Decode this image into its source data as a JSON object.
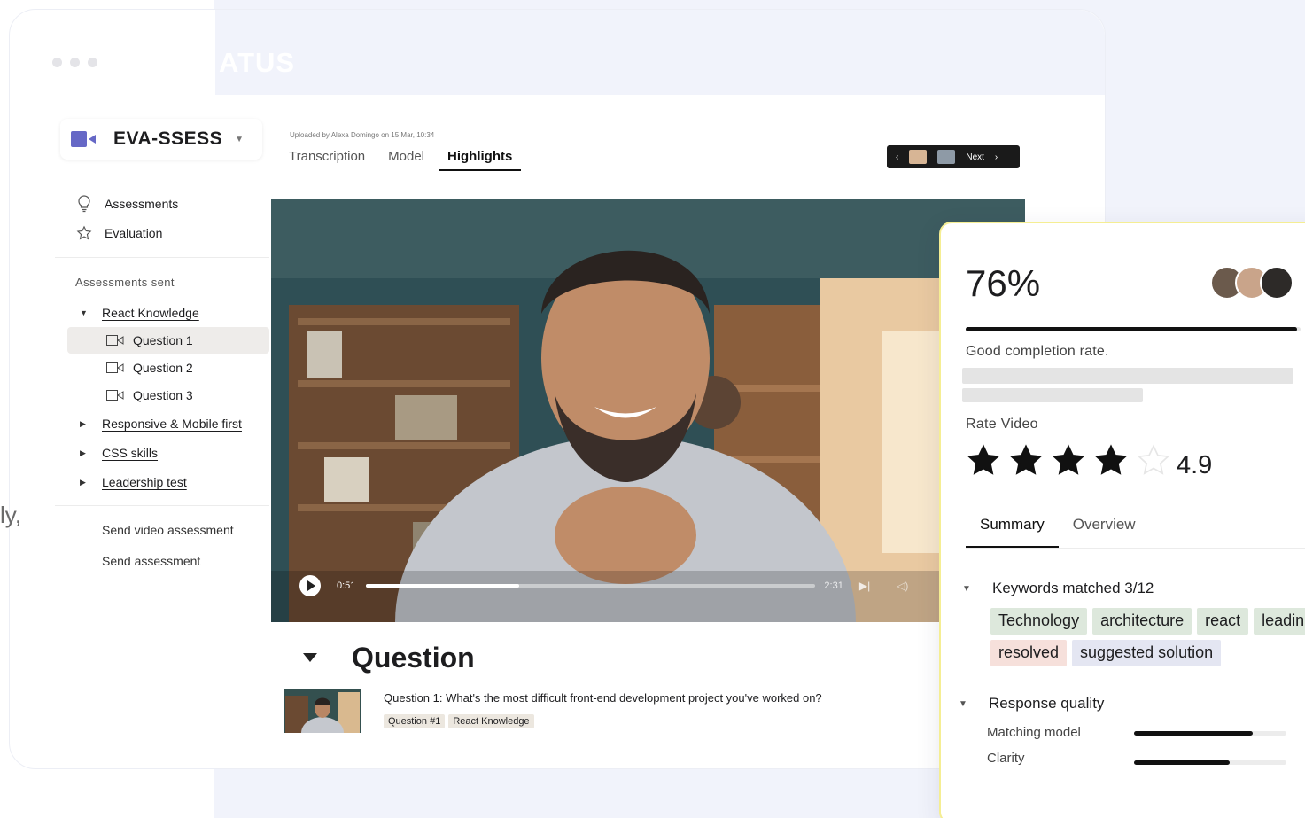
{
  "window": {
    "brand_ghost": "ATUS",
    "side_text": "ly,"
  },
  "app": {
    "logo_text": "EVA-SSESS",
    "nav": [
      {
        "label": "Assessments",
        "icon": "lightbulb-icon"
      },
      {
        "label": "Evaluation",
        "icon": "star-outline-icon"
      }
    ],
    "section_label": "Assessments sent",
    "groups": [
      {
        "label": "React Knowledge",
        "expanded": true
      },
      {
        "label": "Responsive & Mobile first",
        "expanded": false
      },
      {
        "label": "CSS skills",
        "expanded": false
      },
      {
        "label": "Leadership test",
        "expanded": false
      }
    ],
    "questions": [
      {
        "label": "Question 1",
        "selected": true
      },
      {
        "label": "Question 2",
        "selected": false
      },
      {
        "label": "Question 3",
        "selected": false
      }
    ],
    "send_items": [
      "Send video assessment",
      "Send assessment"
    ]
  },
  "header": {
    "upload_meta": "Uploaded by Alexa Domingo on 15 Mar, 10:34",
    "tabs": [
      {
        "label": "Transcription",
        "active": false
      },
      {
        "label": "Model",
        "active": false
      },
      {
        "label": "Highlights",
        "active": true
      }
    ],
    "next_label": "Next"
  },
  "video": {
    "current_time": "0:51",
    "end_time": "2:31",
    "progress": 0.34
  },
  "question": {
    "title": "Question",
    "text": "Question 1: What's the most difficult front-end development project you've worked on?",
    "tags": [
      "Question #1",
      "React Knowledge"
    ]
  },
  "score": {
    "percent": "76%",
    "completion_value": 0.99,
    "completion_text": "Good completion rate.",
    "rate_label": "Rate Video",
    "stars_filled": 4,
    "stars_total": 5,
    "rating": "4.9",
    "tabs": [
      {
        "label": "Summary",
        "active": true
      },
      {
        "label": "Overview",
        "active": false
      }
    ],
    "keywords_title": "Keywords matched 3/12",
    "keywords": [
      {
        "label": "Technology",
        "tone": "green"
      },
      {
        "label": "architecture",
        "tone": "green"
      },
      {
        "label": "react",
        "tone": "green"
      },
      {
        "label": "leading",
        "tone": "green"
      },
      {
        "label": "resolved",
        "tone": "red"
      },
      {
        "label": "suggested solution",
        "tone": "blue"
      }
    ],
    "response_quality_title": "Response quality",
    "metrics": [
      {
        "label": "Matching model",
        "value": 0.78
      },
      {
        "label": "Clarity",
        "value": 0.63
      }
    ]
  },
  "colors": {
    "accent": "#6668c6",
    "card_border": "#f5ee93",
    "background": "#f1f3fb"
  }
}
